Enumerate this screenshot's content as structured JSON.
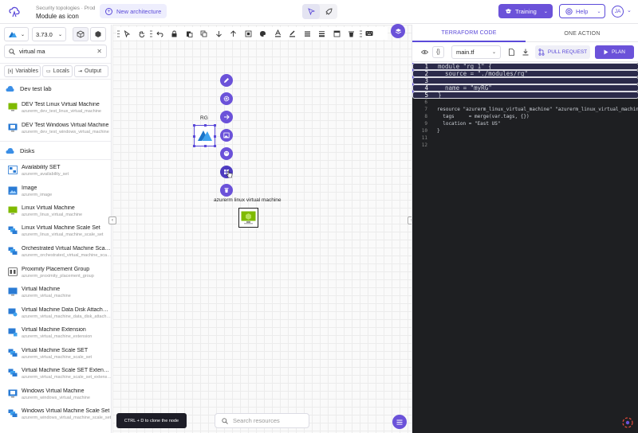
{
  "header": {
    "breadcrumb": "Security topologies · Prod",
    "title": "Module as icon",
    "new_architecture": "New architecture",
    "training": "Training",
    "help": "Help",
    "avatar": "JA",
    "accent": "#6b52d9"
  },
  "sidebar": {
    "provider_icon": "azure-icon",
    "version": "3.73.0",
    "search_value": "virtual ma",
    "tabs": [
      "Variables",
      "Locals",
      "Output"
    ],
    "sections": [
      {
        "title": "Dev test lab",
        "items": [
          {
            "title": "DEV Test Linux Virtual Machine",
            "sub": "azurerm_dev_test_linux_virtual_machine"
          },
          {
            "title": "DEV Test Windows Virtual Machine",
            "sub": "azurerm_dev_test_windows_virtual_machine"
          }
        ]
      },
      {
        "title": "Disks",
        "items": [
          {
            "title": "Availability SET",
            "sub": "azurerm_availability_set"
          },
          {
            "title": "Image",
            "sub": "azurerm_image"
          },
          {
            "title": "Linux Virtual Machine",
            "sub": "azurerm_linux_virtual_machine"
          },
          {
            "title": "Linux Virtual Machine Scale Set",
            "sub": "azurerm_linux_virtual_machine_scale_set"
          },
          {
            "title": "Orchestrated Virtual Machine Scale Set",
            "sub": "azurerm_orchestrated_virtual_machine_scale_set"
          },
          {
            "title": "Proximity Placement Group",
            "sub": "azurerm_proximity_placement_group"
          },
          {
            "title": "Virtual Machine",
            "sub": "azurerm_virtual_machine"
          },
          {
            "title": "Virtual Machine Data Disk Attachment",
            "sub": "azurerm_virtual_machine_data_disk_attachment"
          },
          {
            "title": "Virtual Machine Extension",
            "sub": "azurerm_virtual_machine_extension"
          },
          {
            "title": "Virtual Machine Scale SET",
            "sub": "azurerm_virtual_machine_scale_set"
          },
          {
            "title": "Virtual Machine Scale SET Extension",
            "sub": "azurerm_virtual_machine_scale_set_extension"
          },
          {
            "title": "Windows Virtual Machine",
            "sub": "azurerm_windows_virtual_machine"
          },
          {
            "title": "Windows Virtual Machine Scale Set",
            "sub": "azurerm_windows_virtual_machine_scale_set"
          }
        ]
      }
    ]
  },
  "canvas": {
    "rg_label": "RG",
    "vm_label": "azurerm linux virtual machine",
    "hint": "CTRL + D to clone the node",
    "search_placeholder": "Search resources"
  },
  "right_panel": {
    "tabs": [
      "TERRAFORM CODE",
      "ONE ACTION"
    ],
    "file": "main.tf",
    "pull_request": "PULL REQUEST",
    "plan": "PLAN",
    "code_lines": [
      "module \"rg_1\" {",
      "  source = \"./modules/rg\"",
      "",
      "  name = \"myRG\"",
      "}",
      "",
      "resource \"azurerm_linux_virtual_machine\" \"azurerm_linux_virtual_machine",
      "  tags     = merge(var.tags, {})",
      "  location = \"East US\"",
      "}",
      "",
      ""
    ]
  }
}
